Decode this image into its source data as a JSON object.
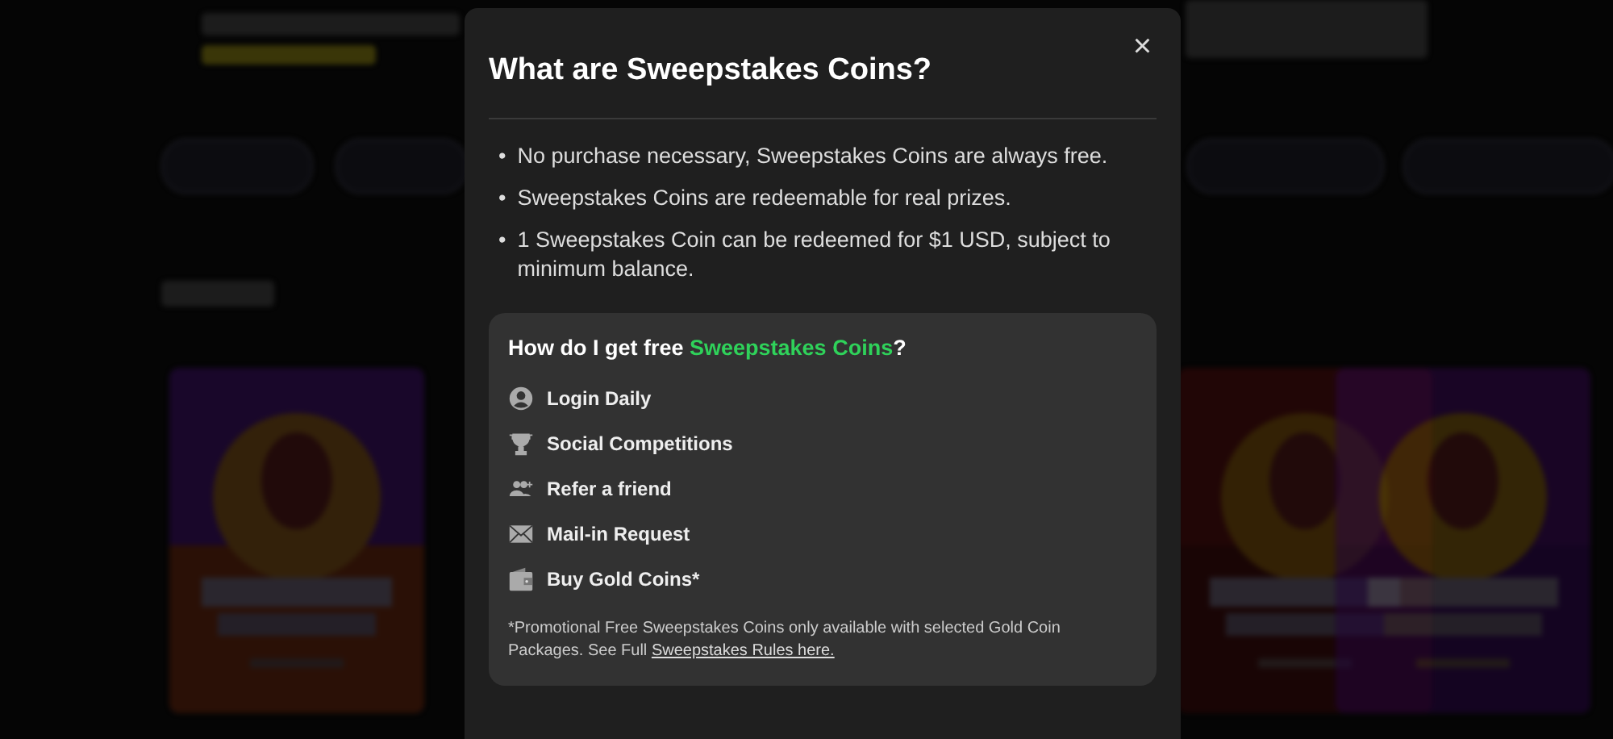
{
  "modal": {
    "title": "What are Sweepstakes Coins?",
    "close": "×",
    "marker": "•",
    "bullets": [
      "No purchase necessary, Sweepstakes Coins are always free.",
      "Sweepstakes Coins are redeemable for real prizes.",
      "1 Sweepstakes Coin can be redeemed for $1 USD, subject to minimum balance."
    ],
    "card": {
      "heading": "How do I get free **Sweepstakes Coins**?",
      "items": [
        {
          "kind": "user",
          "label": "Login Daily"
        },
        {
          "kind": "trophy",
          "label": "Social Competitions"
        },
        {
          "kind": "users",
          "label": "Refer a friend"
        },
        {
          "kind": "mail",
          "label": "Mail-in Request"
        },
        {
          "kind": "wallet",
          "label": "Buy Gold Coins*"
        }
      ],
      "footnote": "*Promotional Free Sweepstakes Coins only available with selected Gold Coin Packages. See Full",
      "link": "Sweepstakes Rules here."
    }
  }
}
